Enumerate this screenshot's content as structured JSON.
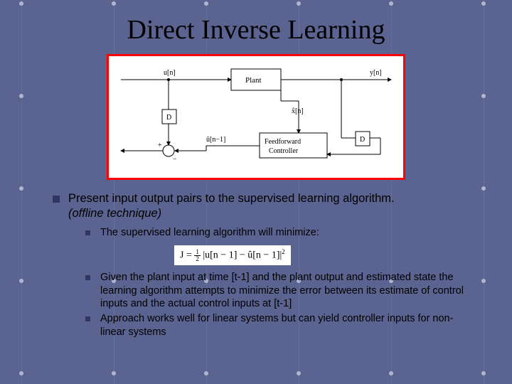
{
  "title": "Direct Inverse Learning",
  "diagram": {
    "u_label": "u[n]",
    "plant": "Plant",
    "y_label": "y[n]",
    "delay": "D",
    "xhat": "x̂[n]",
    "uhat": "û[n−1]",
    "ffc": "Feedforward\nController"
  },
  "bullet_main": "Present input output pairs to the supervised learning algorithm.",
  "bullet_main_italic": "(offline technique)",
  "sub1": "The supervised learning algorithm will minimize:",
  "formula": {
    "prefix": "J = ",
    "frac_top": "1",
    "frac_bot": "2",
    "body": " |u[n − 1] − û[n − 1]|",
    "exp": "2"
  },
  "sub2": "Given the plant input at time [t-1] and the plant output and estimated state the learning algorithm attempts to minimize the error between its estimate of control inputs and the actual control inputs at [t-1]",
  "sub3": "Approach works well for linear systems but can yield controller inputs for non-linear systems"
}
